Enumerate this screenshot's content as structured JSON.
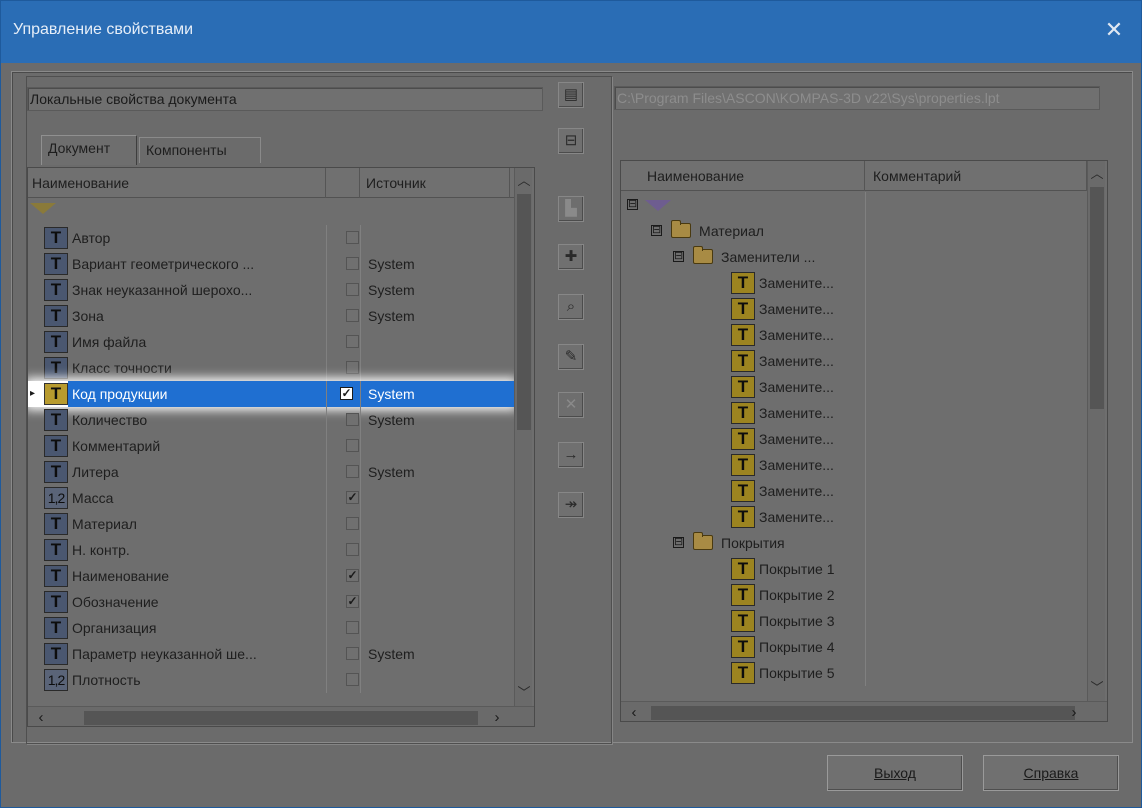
{
  "window": {
    "title": "Управление свойствами",
    "close_glyph": "✕"
  },
  "left": {
    "doc_props_label": "Локальные свойства документа",
    "tabs": [
      {
        "label": "Документ",
        "active": true
      },
      {
        "label": "Компоненты",
        "active": false
      }
    ],
    "columns": {
      "name": "Наименование",
      "check": "",
      "source": "Источник"
    },
    "rows": [
      {
        "icon": "T",
        "name": "Автор",
        "checked": false,
        "source": ""
      },
      {
        "icon": "T",
        "name": "Вариант геометрического ...",
        "checked": false,
        "source": "System"
      },
      {
        "icon": "T",
        "name": "Знак неуказанной шерохо...",
        "checked": false,
        "source": "System"
      },
      {
        "icon": "T",
        "name": "Зона",
        "checked": false,
        "source": "System"
      },
      {
        "icon": "T",
        "name": "Имя файла",
        "checked": false,
        "source": ""
      },
      {
        "icon": "T",
        "name": "Класс точности",
        "checked": false,
        "source": ""
      },
      {
        "icon": "T",
        "name": "Код продукции",
        "checked": true,
        "source": "System",
        "selected": true
      },
      {
        "icon": "T",
        "name": "Количество",
        "checked": false,
        "source": "System"
      },
      {
        "icon": "T",
        "name": "Комментарий",
        "checked": false,
        "source": ""
      },
      {
        "icon": "T",
        "name": "Литера",
        "checked": false,
        "source": "System"
      },
      {
        "icon": "1,2",
        "name": "Масса",
        "checked": true,
        "source": ""
      },
      {
        "icon": "T",
        "name": "Материал",
        "checked": false,
        "source": ""
      },
      {
        "icon": "T",
        "name": "Н. контр.",
        "checked": false,
        "source": ""
      },
      {
        "icon": "T",
        "name": "Наименование",
        "checked": true,
        "source": ""
      },
      {
        "icon": "T",
        "name": "Обозначение",
        "checked": true,
        "source": ""
      },
      {
        "icon": "T",
        "name": "Организация",
        "checked": false,
        "source": ""
      },
      {
        "icon": "T",
        "name": "Параметр неуказанной ше...",
        "checked": false,
        "source": "System"
      },
      {
        "icon": "1,2",
        "name": "Плотность",
        "checked": false,
        "source": ""
      }
    ]
  },
  "toolbar": {
    "buttons": [
      {
        "name": "library-icon",
        "glyph": "▤",
        "enabled": true
      },
      {
        "name": "save-to-library-icon",
        "glyph": "⊟",
        "enabled": true
      },
      {
        "name": "folder-up-icon",
        "glyph": "▙",
        "enabled": false
      },
      {
        "name": "add-property-icon",
        "glyph": "✚",
        "enabled": true
      },
      {
        "name": "find-icon",
        "glyph": "⌕",
        "enabled": true
      },
      {
        "name": "edit-pencil-icon",
        "glyph": "✎",
        "enabled": true
      },
      {
        "name": "delete-icon",
        "glyph": "✕",
        "enabled": false
      },
      {
        "name": "copy-arrow-icon",
        "glyph": "→",
        "enabled": true
      },
      {
        "name": "copy-all-arrow-icon",
        "glyph": "↠",
        "enabled": true
      }
    ]
  },
  "right": {
    "path": "C:\\Program Files\\ASCON\\KOMPAS-3D v22\\Sys\\properties.lpt",
    "columns": {
      "name": "Наименование",
      "comment": "Комментарий"
    },
    "tree": [
      {
        "level": 0,
        "kind": "root",
        "label": "",
        "expander": "⊟"
      },
      {
        "level": 1,
        "kind": "folder",
        "label": "Материал",
        "expander": "⊟"
      },
      {
        "level": 2,
        "kind": "folder",
        "label": "Заменители ...",
        "expander": "⊟"
      },
      {
        "level": 3,
        "kind": "prop",
        "label": "Замените..."
      },
      {
        "level": 3,
        "kind": "prop",
        "label": "Замените..."
      },
      {
        "level": 3,
        "kind": "prop",
        "label": "Замените..."
      },
      {
        "level": 3,
        "kind": "prop",
        "label": "Замените..."
      },
      {
        "level": 3,
        "kind": "prop",
        "label": "Замените..."
      },
      {
        "level": 3,
        "kind": "prop",
        "label": "Замените..."
      },
      {
        "level": 3,
        "kind": "prop",
        "label": "Замените..."
      },
      {
        "level": 3,
        "kind": "prop",
        "label": "Замените..."
      },
      {
        "level": 3,
        "kind": "prop",
        "label": "Замените..."
      },
      {
        "level": 3,
        "kind": "prop",
        "label": "Замените..."
      },
      {
        "level": 2,
        "kind": "folder",
        "label": "Покрытия",
        "expander": "⊟"
      },
      {
        "level": 3,
        "kind": "prop",
        "label": "Покрытие 1"
      },
      {
        "level": 3,
        "kind": "prop",
        "label": "Покрытие 2"
      },
      {
        "level": 3,
        "kind": "prop",
        "label": "Покрытие 3"
      },
      {
        "level": 3,
        "kind": "prop",
        "label": "Покрытие 4"
      },
      {
        "level": 3,
        "kind": "prop",
        "label": "Покрытие 5"
      }
    ]
  },
  "buttons": {
    "exit": "Выход",
    "help": "Справка"
  },
  "colors": {
    "titlebar": "#2a6db5",
    "selection": "#1f6fd1"
  }
}
